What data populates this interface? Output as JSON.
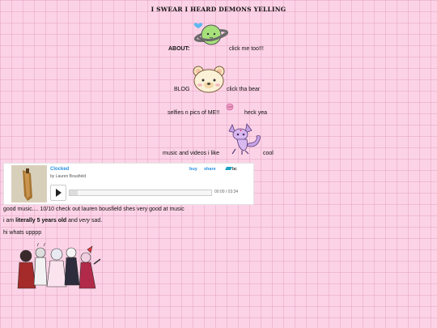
{
  "title": "I SWEAR I HEARD DEMONS YELLING",
  "about": {
    "label": "ABOUT:",
    "link": "click me too!!!"
  },
  "blog": {
    "label": "BLOG",
    "link": "click tha bear"
  },
  "selfies": {
    "label": "selfies n pics of ME!!",
    "link": "heck yea"
  },
  "music": {
    "label": "music and videos i like",
    "link": "cool"
  },
  "player": {
    "track_title": "Clocked",
    "artist_line": "by Lauren Bousfield",
    "buy_label": "buy",
    "share_label": "share",
    "brand": "bc",
    "time": "00:00 / 03:34",
    "progress": 0
  },
  "paragraphs": {
    "p1": "good music.... 10/10 check out lauren bousfield shes very good at music",
    "p2_a": "i am ",
    "p2_b": "literally 5 years old",
    "p2_c": " and ",
    "p2_d": "very",
    "p2_e": " sad.",
    "p3": "hi whats upppp"
  }
}
